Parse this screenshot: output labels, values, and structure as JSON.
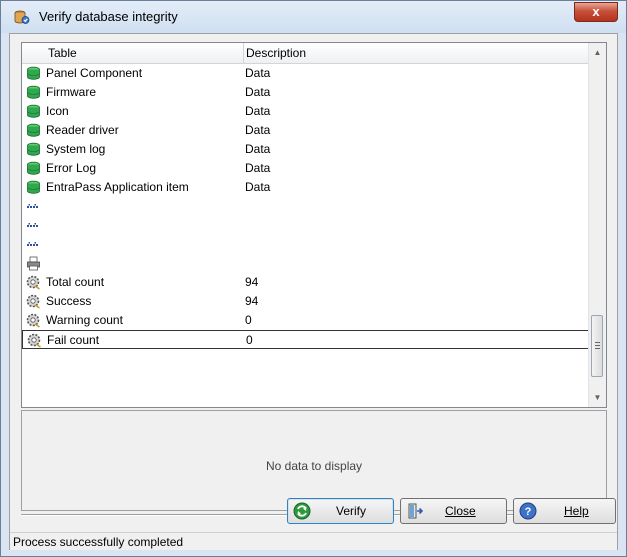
{
  "window": {
    "title": "Verify database integrity",
    "close_glyph": "x"
  },
  "grid": {
    "columns": {
      "table": "Table",
      "description": "Description"
    },
    "rows": [
      {
        "icon": "green-db-icon",
        "table": "Panel Component",
        "description": "Data"
      },
      {
        "icon": "green-db-icon",
        "table": "Firmware",
        "description": "Data"
      },
      {
        "icon": "green-db-icon",
        "table": "Icon",
        "description": "Data"
      },
      {
        "icon": "green-db-icon",
        "table": "Reader driver",
        "description": "Data"
      },
      {
        "icon": "green-db-icon",
        "table": "System log",
        "description": "Data"
      },
      {
        "icon": "green-db-icon",
        "table": "Error Log",
        "description": "Data"
      },
      {
        "icon": "green-db-icon",
        "table": "EntraPass Application item",
        "description": "Data"
      },
      {
        "icon": "dotted-separator-icon",
        "table": "",
        "description": ""
      },
      {
        "icon": "dotted-separator-icon",
        "table": "",
        "description": ""
      },
      {
        "icon": "dotted-separator-icon",
        "table": "",
        "description": ""
      },
      {
        "icon": "printer-icon",
        "table": "",
        "description": ""
      },
      {
        "icon": "gear-icon",
        "table": "Total count",
        "description": "94"
      },
      {
        "icon": "gear-icon",
        "table": "Success",
        "description": "94"
      },
      {
        "icon": "gear-icon",
        "table": "Warning count",
        "description": "0"
      },
      {
        "icon": "gear-icon",
        "table": "Fail count",
        "description": "0"
      }
    ]
  },
  "detail": {
    "empty_text": "No data to display"
  },
  "buttons": {
    "verify": {
      "label": "Verify",
      "icon": "refresh-icon"
    },
    "close": {
      "label": "Close",
      "icon": "exit-door-icon"
    },
    "help": {
      "label": "Help",
      "icon": "help-icon"
    }
  },
  "status": {
    "text": "Process successfully completed"
  },
  "colors": {
    "title_bg": "#dbe6f4",
    "close_red": "#c7503a",
    "green_db": "#2fa84f",
    "row_selected_border": "#333333"
  }
}
